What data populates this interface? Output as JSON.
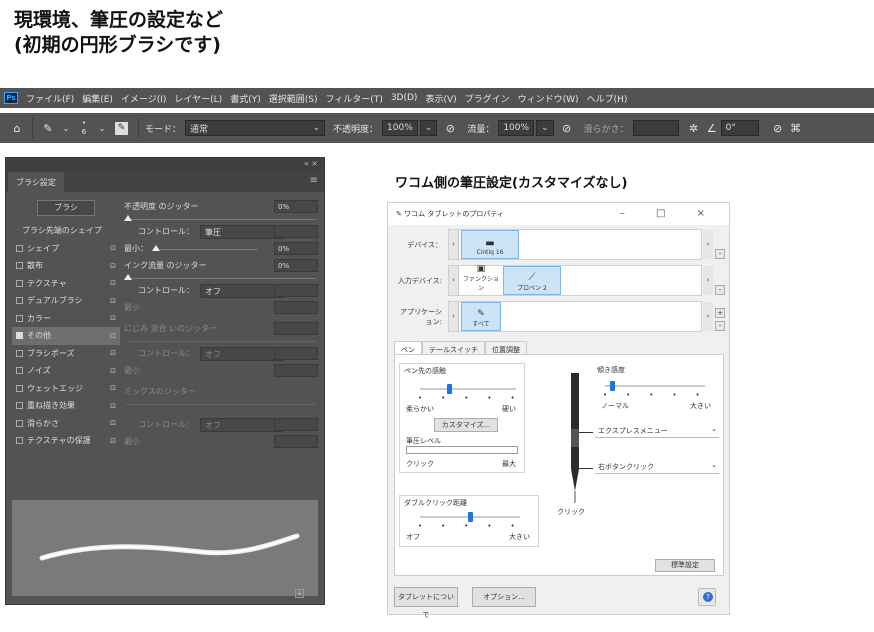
{
  "heading": {
    "line1": "現環境、筆圧の設定など",
    "line2": "(初期の円形ブラシです)"
  },
  "menubar": {
    "logo": "Ps",
    "items": [
      "ファイル(F)",
      "編集(E)",
      "イメージ(I)",
      "レイヤー(L)",
      "書式(Y)",
      "選択範囲(S)",
      "フィルター(T)",
      "3D(D)",
      "表示(V)",
      "プラグイン",
      "ウィンドウ(W)",
      "ヘルプ(H)"
    ]
  },
  "optionsbar": {
    "home_icon": "home-icon",
    "brush_size": "6",
    "mode_label": "モード：",
    "mode_value": "通常",
    "opacity_label": "不透明度：",
    "opacity_value": "100%",
    "flow_label": "流量：",
    "flow_value": "100%",
    "smoothing_label": "滑らかさ：",
    "smoothing_value": "",
    "angle_value": "0°"
  },
  "brush_panel": {
    "collapse": "«",
    "close": "×",
    "tab": "ブラシ設定",
    "brush_button": "ブラシ",
    "tip_shape": "ブラシ先端のシェイプ",
    "items": [
      {
        "label": "シェイプ",
        "checked": false
      },
      {
        "label": "散布",
        "checked": false
      },
      {
        "label": "テクスチャ",
        "checked": false
      },
      {
        "label": "デュアルブラシ",
        "checked": false
      },
      {
        "label": "カラー",
        "checked": false
      },
      {
        "label": "その他",
        "checked": true
      },
      {
        "label": "ブラシポーズ",
        "checked": false
      },
      {
        "label": "ノイズ",
        "checked": false
      },
      {
        "label": "ウェットエッジ",
        "checked": false
      },
      {
        "label": "重ね描き効果",
        "checked": false
      },
      {
        "label": "滑らかさ",
        "checked": false
      },
      {
        "label": "テクスチャの保護",
        "checked": false
      }
    ],
    "opacity_jitter": "不透明度 のジッター",
    "opacity_jitter_value": "0%",
    "control_label": "コントロール：",
    "control_value1": "筆圧",
    "min_label": "最小：",
    "min_value": "0%",
    "flow_jitter": "インク流量 のジッター",
    "flow_jitter_value": "0%",
    "control_value2": "オフ",
    "min_label2": "最小",
    "wet_jitter": "にじみ 混合 いのジッター",
    "control_value3": "オフ",
    "min_label3": "最小",
    "mix_jitter": "ミックスのジッター",
    "control_value4": "オフ",
    "min_label4": "最小",
    "footer_icon": "+"
  },
  "wacom": {
    "title": "ワコム側の筆圧設定(カスタマイズなし)",
    "window_title": "ワコム タブレットのプロパティ",
    "window_controls": "– □ ×",
    "device_label": "デバイス：",
    "device_name": "Cintiq 16",
    "input_label": "入力デバイス:",
    "input_function": "ファンクション",
    "input_pen": "プロペン 2",
    "app_label": "アプリケーション:",
    "app_all": "すべて",
    "tabs": [
      "ペン",
      "テールスイッチ",
      "位置調整"
    ],
    "tip_feel": "ペン先の感触",
    "soft": "柔らかい",
    "firm": "硬い",
    "customize": "カスタマイズ...",
    "pressure_level": "筆圧レベル",
    "click": "クリック",
    "max": "最大",
    "double_click": "ダブルクリック距離",
    "off": "オフ",
    "large": "大きい",
    "tilt": "傾き感度",
    "normal": "ノーマル",
    "high": "大きい",
    "btn_upper": "エクスプレスメニュー",
    "btn_lower": "右ボタンクリック",
    "pen_tip": "クリック",
    "defaults": "標準設定",
    "about": "タブレットについて",
    "options": "オプション...",
    "tip_feel_level": 0.3,
    "tilt_level": 0.05,
    "double_click_level": 0.5
  }
}
